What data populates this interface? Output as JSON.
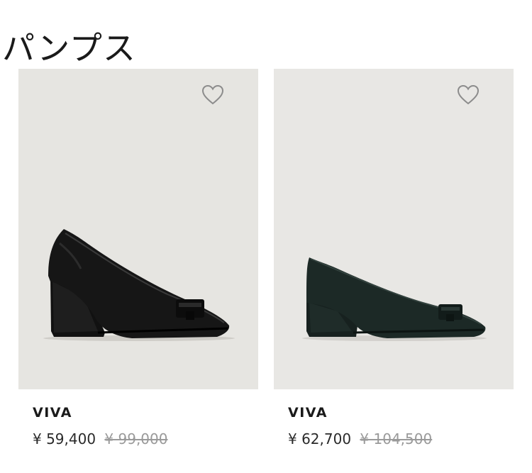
{
  "page": {
    "title": "パンプス"
  },
  "products": [
    {
      "name": "VIVA",
      "price_current": "¥ 59,400",
      "price_original": "¥ 99,000",
      "color": "#141414",
      "wishlist_icon": "heart-outline-icon"
    },
    {
      "name": "VIVA",
      "price_current": "¥ 62,700",
      "price_original": "¥ 104,500",
      "color": "#1b2926",
      "wishlist_icon": "heart-outline-icon"
    }
  ]
}
